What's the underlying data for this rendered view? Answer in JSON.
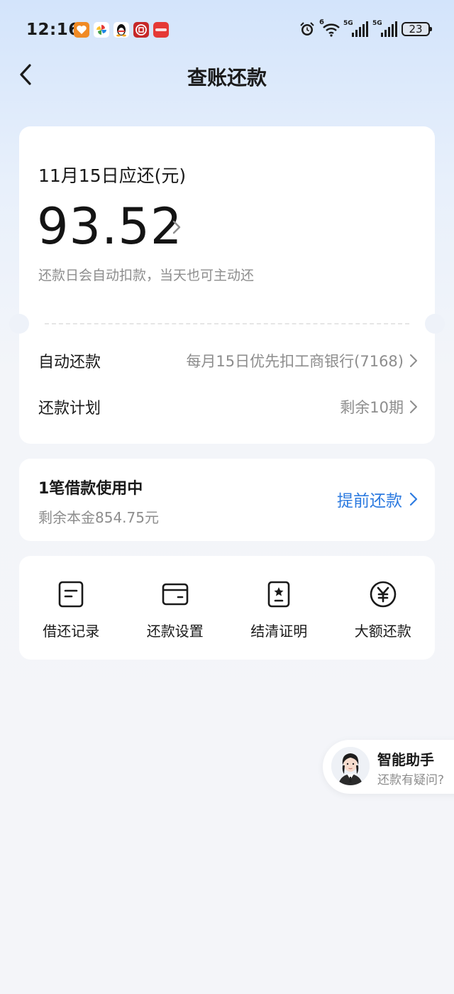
{
  "status_bar": {
    "time": "12:16",
    "battery": "23",
    "network_1": "5G",
    "network_2": "5G",
    "wifi_tag": "6",
    "app_icons": [
      "heart-app-icon",
      "pinwheel-app-icon",
      "qq-penguin-icon",
      "bank-app-icon",
      "red-app-icon"
    ]
  },
  "nav": {
    "title": "查账还款"
  },
  "bill": {
    "due_label": "11月15日应还(元)",
    "amount": "93.52",
    "hint": "还款日会自动扣款，当天也可主动还",
    "auto_repay_label": "自动还款",
    "auto_repay_value": "每月15日优先扣工商银行(7168)",
    "plan_label": "还款计划",
    "plan_value": "剩余10期"
  },
  "loan": {
    "title": "1笔借款使用中",
    "remaining": "剩余本金854.75元",
    "prepay_label": "提前还款"
  },
  "grid": [
    {
      "label": "借还记录",
      "icon": "record-icon"
    },
    {
      "label": "还款设置",
      "icon": "wallet-icon"
    },
    {
      "label": "结清证明",
      "icon": "certificate-icon"
    },
    {
      "label": "大额还款",
      "icon": "yuan-icon"
    }
  ],
  "assistant": {
    "title": "智能助手",
    "subtitle": "还款有疑问?"
  },
  "colors": {
    "accent": "#2d7be0",
    "muted": "#8d8d8d",
    "text": "#1a1a1a"
  }
}
